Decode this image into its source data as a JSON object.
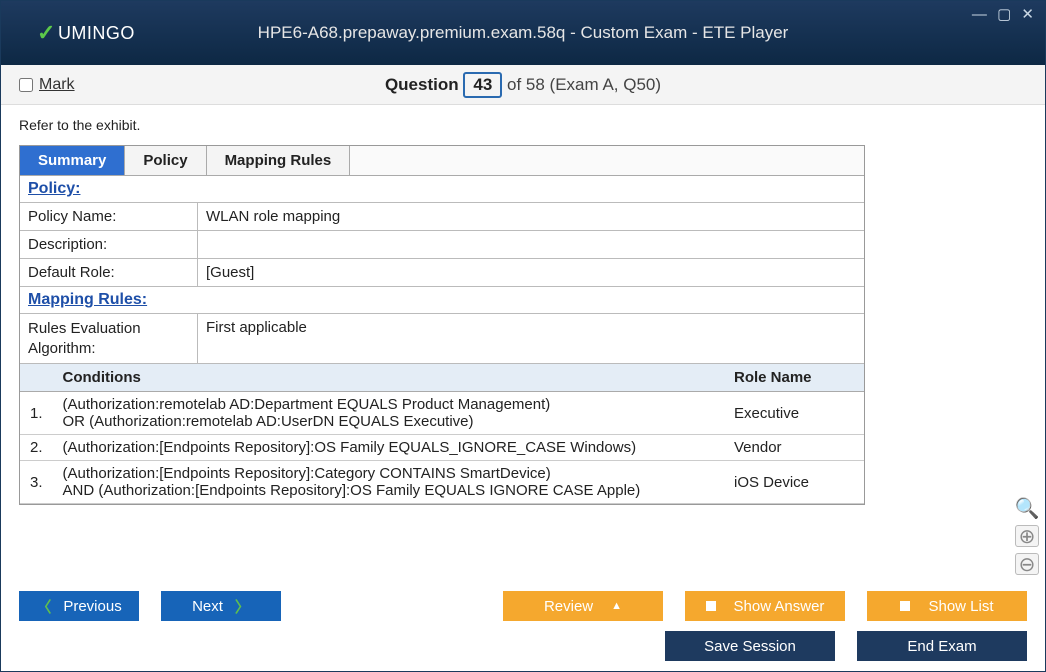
{
  "title": "HPE6-A68.prepaway.premium.exam.58q - Custom Exam - ETE Player",
  "logo": "UMINGO",
  "mark_label": "Mark",
  "qhead": {
    "word_question": "Question",
    "current": "43",
    "rest": "of 58 (Exam A, Q50)"
  },
  "refer": "Refer to the exhibit.",
  "tabs": {
    "t0": "Summary",
    "t1": "Policy",
    "t2": "Mapping Rules"
  },
  "sect": {
    "policy": "Policy:",
    "rules": "Mapping Rules:"
  },
  "policy": {
    "name_label": "Policy Name:",
    "name_value": "WLAN role mapping",
    "desc_label": "Description:",
    "desc_value": "",
    "default_label": "Default Role:",
    "default_value": "[Guest]"
  },
  "rules": {
    "algo_label": "Rules Evaluation Algorithm:",
    "algo_value": "First applicable",
    "cond_header": "Conditions",
    "role_header": "Role Name",
    "r1n": "1.",
    "r1c": "(Authorization:remotelab AD:Department EQUALS Product Management)\nOR (Authorization:remotelab AD:UserDN EQUALS Executive)",
    "r1r": "Executive",
    "r2n": "2.",
    "r2c": "(Authorization:[Endpoints Repository]:OS Family EQUALS_IGNORE_CASE Windows)",
    "r2r": "Vendor",
    "r3n": "3.",
    "r3c": "(Authorization:[Endpoints Repository]:Category CONTAINS SmartDevice)\nAND (Authorization:[Endpoints Repository]:OS Family EQUALS  IGNORE  CASE Apple)",
    "r3r": "iOS Device"
  },
  "buttons": {
    "prev": "Previous",
    "next": "Next",
    "review": "Review",
    "showans": "Show Answer",
    "showlist": "Show List",
    "save": "Save Session",
    "end": "End Exam"
  }
}
